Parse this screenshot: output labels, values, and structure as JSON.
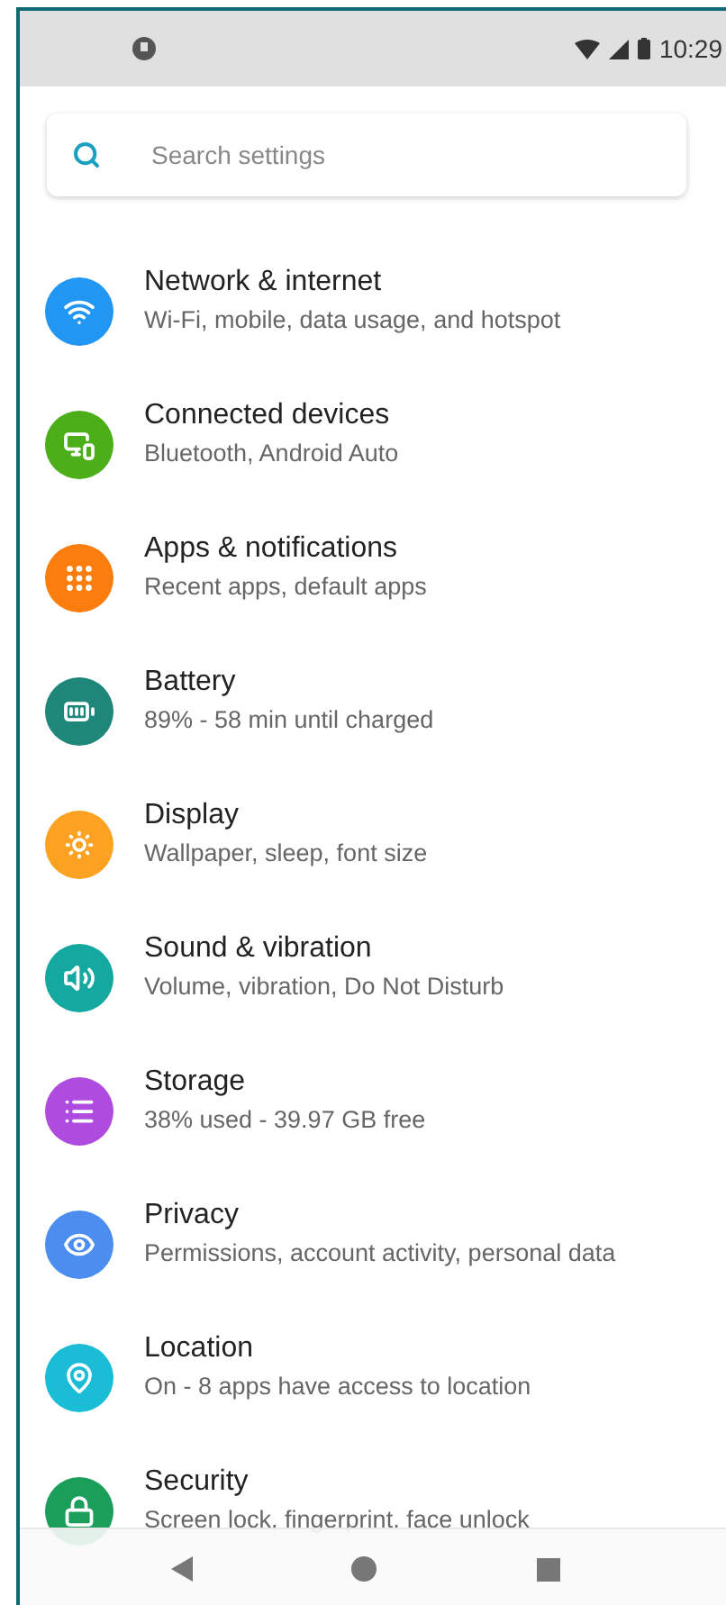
{
  "status_bar": {
    "time": "10:29"
  },
  "search": {
    "placeholder": "Search settings"
  },
  "items": [
    {
      "title": "Network & internet",
      "subtitle": "Wi-Fi, mobile, data usage, and hotspot",
      "color": "#2196f3"
    },
    {
      "title": "Connected devices",
      "subtitle": "Bluetooth, Android Auto",
      "color": "#4caf1a"
    },
    {
      "title": "Apps & notifications",
      "subtitle": "Recent apps, default apps",
      "color": "#fb7d0e"
    },
    {
      "title": "Battery",
      "subtitle": "89% - 58 min until charged",
      "color": "#1f877a"
    },
    {
      "title": "Display",
      "subtitle": "Wallpaper, sleep, font size",
      "color": "#fba222"
    },
    {
      "title": "Sound & vibration",
      "subtitle": "Volume, vibration, Do Not Disturb",
      "color": "#14a8a0"
    },
    {
      "title": "Storage",
      "subtitle": "38% used - 39.97 GB free",
      "color": "#b04be0"
    },
    {
      "title": "Privacy",
      "subtitle": "Permissions, account activity, personal data",
      "color": "#4b8ef0"
    },
    {
      "title": "Location",
      "subtitle": "On - 8 apps have access to location",
      "color": "#1bbcd6"
    },
    {
      "title": "Security",
      "subtitle": "Screen lock, fingerprint, face unlock",
      "color": "#1a9e5a"
    }
  ]
}
